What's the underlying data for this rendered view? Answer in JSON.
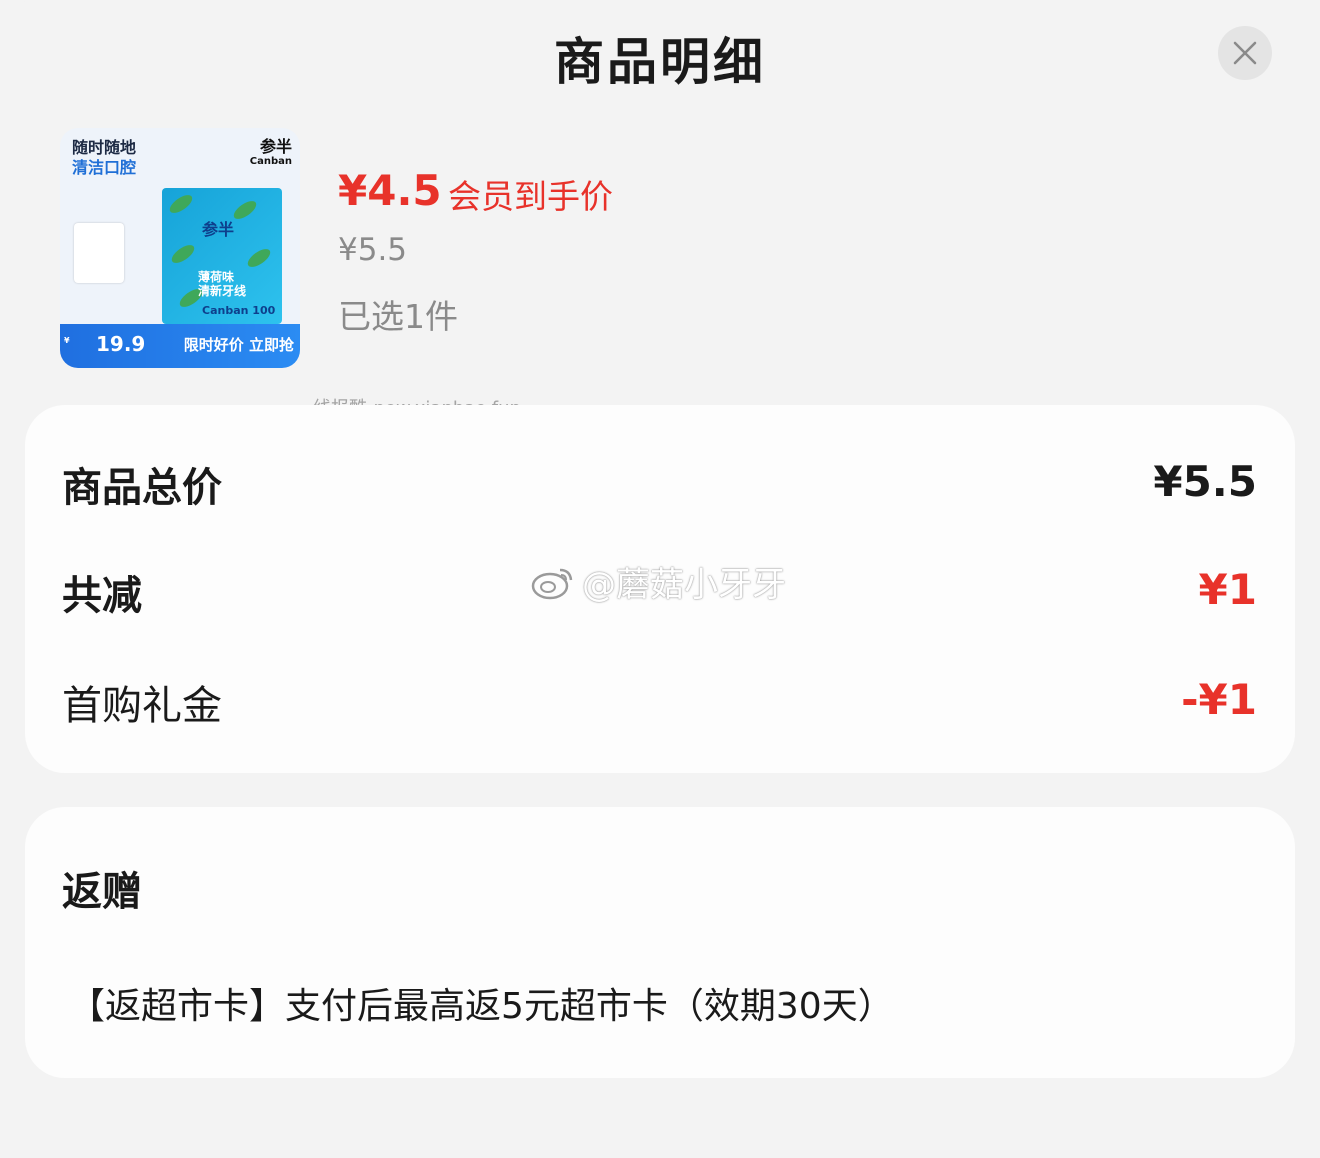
{
  "header": {
    "title": "商品明细",
    "close_icon": "close-icon"
  },
  "product": {
    "image": {
      "line1": "随时随地",
      "line2": "清洁口腔",
      "brand": "参半",
      "brand_sub": "Canban",
      "pack_brand": "参半",
      "pack_flavor": "薄荷味\n清新牙线",
      "pack_count": "Canban  100",
      "bar_price": "19.9",
      "bar_promo": "限时好价 立即抢"
    },
    "member_price": "¥4.5",
    "member_price_label": "会员到手价",
    "original_price": "¥5.5",
    "selected": "已选1件"
  },
  "watermarks": {
    "site": "线报酷-new.xianbao.fun",
    "weibo": "@蘑菇小牙牙"
  },
  "summary": {
    "total_label": "商品总价",
    "total_value": "¥5.5",
    "discount_label": "共减",
    "discount_value": "¥1",
    "gift_label": "首购礼金",
    "gift_value": "-¥1"
  },
  "rebate": {
    "title": "返赠",
    "description": "【返超市卡】支付后最高返5元超市卡（效期30天）"
  },
  "colors": {
    "accent_red": "#e8322a",
    "muted": "#8a8a8a",
    "background": "#f3f3f3",
    "card": "#fdfdfd"
  }
}
